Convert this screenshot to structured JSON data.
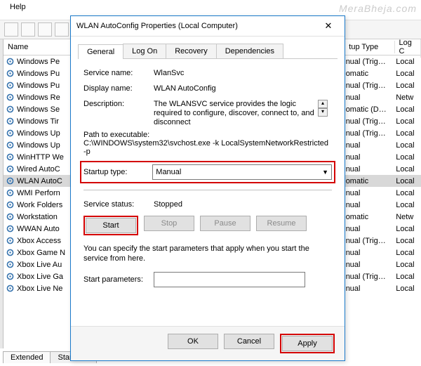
{
  "menubar": {
    "help": "Help"
  },
  "list": {
    "headers": {
      "name": "Name",
      "startup_type": "tup Type",
      "logon": "Log C"
    },
    "rows": [
      {
        "name": "Windows Pe",
        "stype": "nual (Trig…",
        "logon": "Local"
      },
      {
        "name": "Windows Pu",
        "stype": "omatic",
        "logon": "Local"
      },
      {
        "name": "Windows Pu",
        "stype": "nual (Trig…",
        "logon": "Local"
      },
      {
        "name": "Windows Re",
        "stype": "nual",
        "logon": "Netw"
      },
      {
        "name": "Windows Se",
        "stype": "omatic (D…",
        "logon": "Local"
      },
      {
        "name": "Windows Tir",
        "stype": "nual (Trig…",
        "logon": "Local"
      },
      {
        "name": "Windows Up",
        "stype": "nual (Trig…",
        "logon": "Local"
      },
      {
        "name": "Windows Up",
        "stype": "nual",
        "logon": "Local"
      },
      {
        "name": "WinHTTP We",
        "stype": "nual",
        "logon": "Local"
      },
      {
        "name": "Wired AutoC",
        "stype": "nual",
        "logon": "Local"
      },
      {
        "name": "WLAN AutoC",
        "stype": "omatic",
        "logon": "Local",
        "selected": true
      },
      {
        "name": "WMI Perforn",
        "stype": "nual",
        "logon": "Local"
      },
      {
        "name": "Work Folders",
        "stype": "nual",
        "logon": "Local"
      },
      {
        "name": "Workstation",
        "stype": "omatic",
        "logon": "Netw"
      },
      {
        "name": "WWAN Auto",
        "stype": "nual",
        "logon": "Local"
      },
      {
        "name": "Xbox Access",
        "stype": "nual (Trig…",
        "logon": "Local"
      },
      {
        "name": "Xbox Game N",
        "stype": "nual",
        "logon": "Local"
      },
      {
        "name": "Xbox Live Au",
        "stype": "nual",
        "logon": "Local"
      },
      {
        "name": "Xbox Live Ga",
        "stype": "nual (Trig…",
        "logon": "Local"
      },
      {
        "name": "Xbox Live Ne",
        "stype": "nual",
        "logon": "Local"
      }
    ]
  },
  "bottom_tabs": {
    "extended": "Extended",
    "standard": "Standard"
  },
  "dialog": {
    "title": "WLAN AutoConfig Properties (Local Computer)",
    "tabs": {
      "general": "General",
      "logon": "Log On",
      "recovery": "Recovery",
      "dependencies": "Dependencies"
    },
    "labels": {
      "service_name": "Service name:",
      "display_name": "Display name:",
      "description": "Description:",
      "path": "Path to executable:",
      "startup_type": "Startup type:",
      "service_status": "Service status:",
      "start_params": "Start parameters:"
    },
    "values": {
      "service_name": "WlanSvc",
      "display_name": "WLAN AutoConfig",
      "description": "The WLANSVC service provides the logic required to configure, discover, connect to, and disconnect",
      "path": "C:\\WINDOWS\\system32\\svchost.exe -k LocalSystemNetworkRestricted -p",
      "startup_type": "Manual",
      "service_status": "Stopped"
    },
    "buttons": {
      "start": "Start",
      "stop": "Stop",
      "pause": "Pause",
      "resume": "Resume",
      "ok": "OK",
      "cancel": "Cancel",
      "apply": "Apply"
    },
    "note": "You can specify the start parameters that apply when you start the service from here."
  },
  "watermark": "MeraBheja.com"
}
